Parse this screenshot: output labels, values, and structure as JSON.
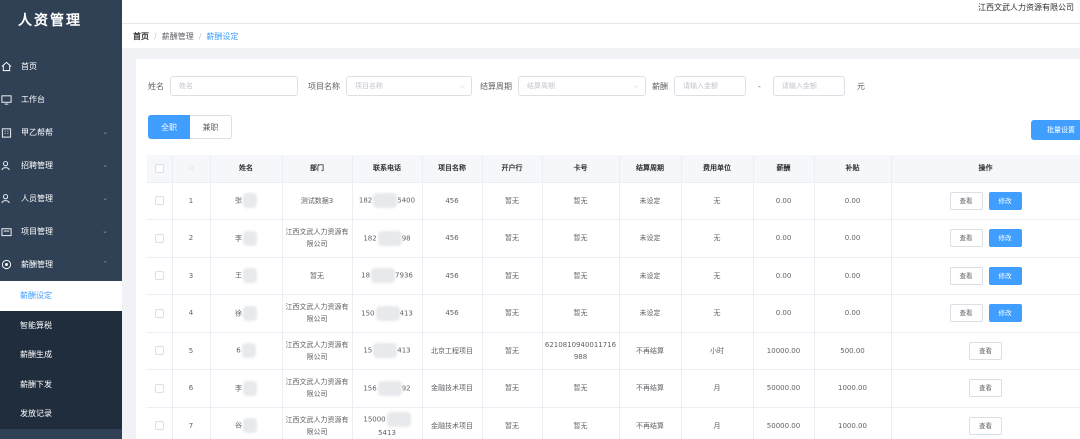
{
  "app": {
    "title": "人资管理",
    "company": "江西文武人力资源有限公司"
  },
  "sidebar": {
    "items": [
      {
        "label": "首页",
        "icon": "home-icon",
        "chevron": false
      },
      {
        "label": "工作台",
        "icon": "monitor-icon",
        "chevron": false
      },
      {
        "label": "甲乙帮帮",
        "icon": "building-icon",
        "chevron": true
      },
      {
        "label": "招聘管理",
        "icon": "user-icon",
        "chevron": true
      },
      {
        "label": "人员管理",
        "icon": "user-icon",
        "chevron": true
      },
      {
        "label": "项目管理",
        "icon": "folder-icon",
        "chevron": true
      },
      {
        "label": "薪酬管理",
        "icon": "gear-icon",
        "chevron": true
      }
    ],
    "sub_items": [
      "薪酬设定",
      "智能算税",
      "薪酬生成",
      "薪酬下发",
      "发放记录"
    ],
    "active_sub": "薪酬设定"
  },
  "breadcrumb": [
    "首页",
    "薪酬管理",
    "薪酬设定"
  ],
  "filters": {
    "name_label": "姓名",
    "name_placeholder": "姓名",
    "project_label": "项目名称",
    "project_placeholder": "项目名称",
    "cycle_label": "结算周期",
    "cycle_placeholder": "结算周期",
    "salary_label": "薪酬",
    "min_placeholder": "请输入金额",
    "dash": "-",
    "max_placeholder": "请输入金额",
    "unit": "元"
  },
  "tabs": [
    "全职",
    "兼职"
  ],
  "batch_button": "批量设置",
  "table": {
    "headers": [
      "",
      "",
      "姓名",
      "部门",
      "联系电话",
      "项目名称",
      "开户行",
      "卡号",
      "结算周期",
      "费用单位",
      "薪酬",
      "补贴",
      "操作"
    ],
    "rows": [
      {
        "idx": "1",
        "name": "张",
        "dept": "测试数据3",
        "phone_a": "182",
        "phone_b": "5400",
        "project": "456",
        "bank": "暂无",
        "card": "暂无",
        "cycle": "未设定",
        "unit": "无",
        "salary": "0.00",
        "subsidy": "0.00",
        "editable": true
      },
      {
        "idx": "2",
        "name": "李",
        "dept": "江西文武人力资源有限公司",
        "phone_a": "182",
        "phone_b": "98",
        "project": "456",
        "bank": "暂无",
        "card": "暂无",
        "cycle": "未设定",
        "unit": "无",
        "salary": "0.00",
        "subsidy": "0.00",
        "editable": true
      },
      {
        "idx": "3",
        "name": "王",
        "dept": "暂无",
        "phone_a": "18",
        "phone_b": "7936",
        "project": "456",
        "bank": "暂无",
        "card": "暂无",
        "cycle": "未设定",
        "unit": "无",
        "salary": "0.00",
        "subsidy": "0.00",
        "editable": true
      },
      {
        "idx": "4",
        "name": "徐",
        "dept": "江西文武人力资源有限公司",
        "phone_a": "150",
        "phone_b": "413",
        "project": "456",
        "bank": "暂无",
        "card": "暂无",
        "cycle": "未设定",
        "unit": "无",
        "salary": "0.00",
        "subsidy": "0.00",
        "editable": true
      },
      {
        "idx": "5",
        "name": "6",
        "dept": "江西文武人力资源有限公司",
        "phone_a": "15",
        "phone_b": "413",
        "project": "北京工程项目",
        "bank": "暂无",
        "card": "6210810940011716988",
        "cycle": "不再结算",
        "unit": "小时",
        "salary": "10000.00",
        "subsidy": "500.00",
        "editable": false
      },
      {
        "idx": "6",
        "name": "李",
        "dept": "江西文武人力资源有限公司",
        "phone_a": "156",
        "phone_b": "92",
        "project": "金融技术项目",
        "bank": "暂无",
        "card": "暂无",
        "cycle": "不再结算",
        "unit": "月",
        "salary": "50000.00",
        "subsidy": "1000.00",
        "editable": false
      },
      {
        "idx": "7",
        "name": "谷",
        "dept": "江西文武人力资源有限公司",
        "phone_a": "15000",
        "phone_b": "5413",
        "project": "金融技术项目",
        "bank": "暂无",
        "card": "暂无",
        "cycle": "不再结算",
        "unit": "月",
        "salary": "50000.00",
        "subsidy": "1000.00",
        "editable": false
      }
    ],
    "view_label": "查看",
    "edit_label": "修改"
  }
}
